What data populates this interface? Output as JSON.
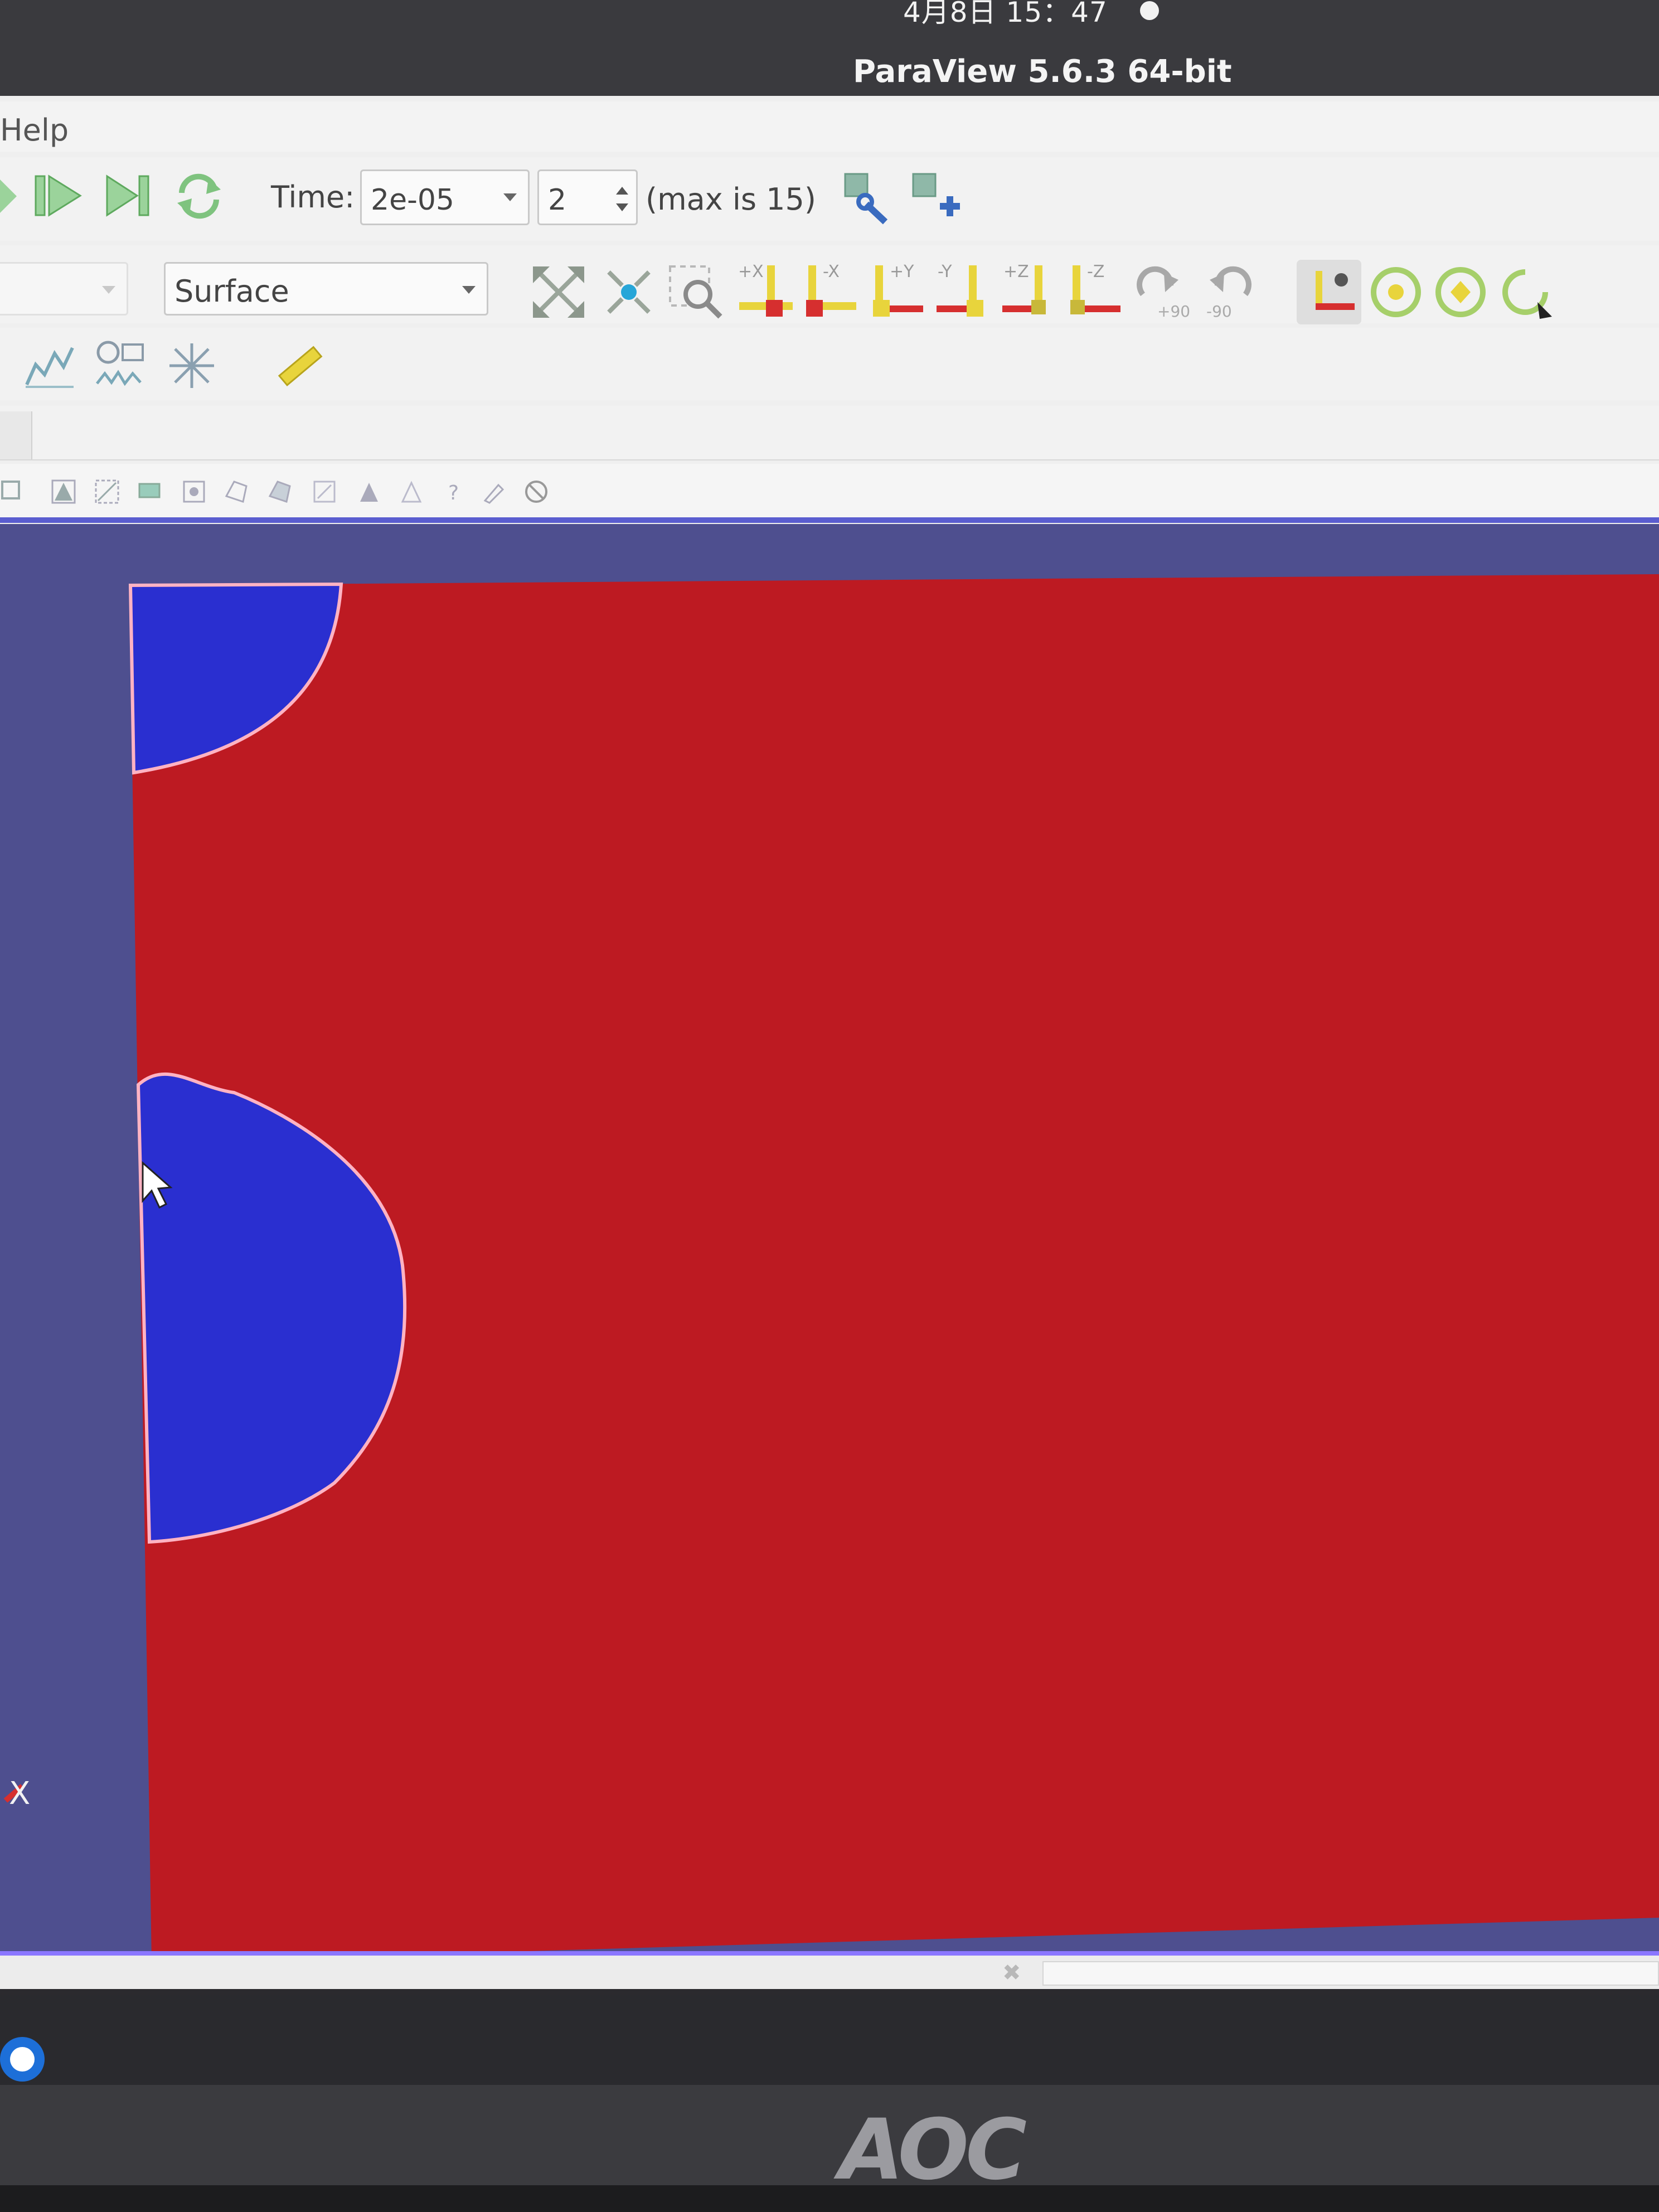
{
  "system_bar": {
    "clock": "4月8日  15：47"
  },
  "window": {
    "title": "ParaView 5.6.3 64-bit"
  },
  "menubar": {
    "help": "Help"
  },
  "toolbar_time": {
    "label": "Time:",
    "time_value": "2e-05",
    "step_value": "2",
    "max_text": "(max is 15)"
  },
  "toolbar_representation": {
    "selected": "Surface"
  },
  "camera_buttons": [
    "+X",
    "-X",
    "+Y",
    "-Y",
    "+Z",
    "-Z"
  ],
  "rotate_buttons": [
    "+90",
    "-90"
  ],
  "status_bar": {
    "close_glyph": "✖"
  },
  "monitor": {
    "brand": "AOC"
  },
  "colors": {
    "field_red": "#c01c24",
    "inclusion_blue": "#2a2fd0",
    "background": "#4e4f8f",
    "interface": "#ff9fb0"
  },
  "axes_label": "X",
  "icon_names": [
    "play-icon",
    "last-frame-icon",
    "loop-icon",
    "camera-undo-icon",
    "camera-add-icon",
    "reset-camera-icon",
    "zoom-to-data-icon",
    "zoom-box-icon",
    "rotate-icon",
    "ruler-icon",
    "plot-icon",
    "time-plot-icon",
    "axes-icon",
    "selection-icon"
  ]
}
